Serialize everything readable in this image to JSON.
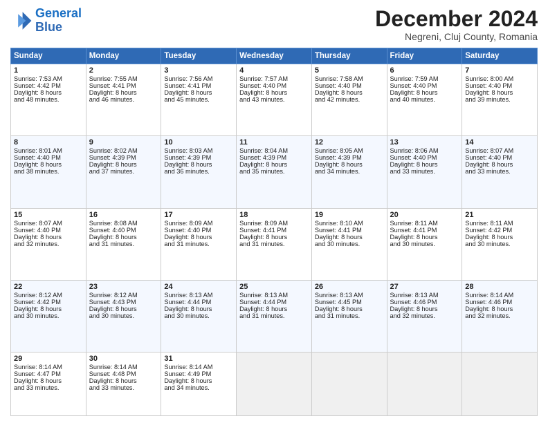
{
  "logo": {
    "line1": "General",
    "line2": "Blue"
  },
  "title": "December 2024",
  "location": "Negreni, Cluj County, Romania",
  "days_header": [
    "Sunday",
    "Monday",
    "Tuesday",
    "Wednesday",
    "Thursday",
    "Friday",
    "Saturday"
  ],
  "weeks": [
    [
      {
        "day": "1",
        "lines": [
          "Sunrise: 7:53 AM",
          "Sunset: 4:42 PM",
          "Daylight: 8 hours",
          "and 48 minutes."
        ]
      },
      {
        "day": "2",
        "lines": [
          "Sunrise: 7:55 AM",
          "Sunset: 4:41 PM",
          "Daylight: 8 hours",
          "and 46 minutes."
        ]
      },
      {
        "day": "3",
        "lines": [
          "Sunrise: 7:56 AM",
          "Sunset: 4:41 PM",
          "Daylight: 8 hours",
          "and 45 minutes."
        ]
      },
      {
        "day": "4",
        "lines": [
          "Sunrise: 7:57 AM",
          "Sunset: 4:40 PM",
          "Daylight: 8 hours",
          "and 43 minutes."
        ]
      },
      {
        "day": "5",
        "lines": [
          "Sunrise: 7:58 AM",
          "Sunset: 4:40 PM",
          "Daylight: 8 hours",
          "and 42 minutes."
        ]
      },
      {
        "day": "6",
        "lines": [
          "Sunrise: 7:59 AM",
          "Sunset: 4:40 PM",
          "Daylight: 8 hours",
          "and 40 minutes."
        ]
      },
      {
        "day": "7",
        "lines": [
          "Sunrise: 8:00 AM",
          "Sunset: 4:40 PM",
          "Daylight: 8 hours",
          "and 39 minutes."
        ]
      }
    ],
    [
      {
        "day": "8",
        "lines": [
          "Sunrise: 8:01 AM",
          "Sunset: 4:40 PM",
          "Daylight: 8 hours",
          "and 38 minutes."
        ]
      },
      {
        "day": "9",
        "lines": [
          "Sunrise: 8:02 AM",
          "Sunset: 4:39 PM",
          "Daylight: 8 hours",
          "and 37 minutes."
        ]
      },
      {
        "day": "10",
        "lines": [
          "Sunrise: 8:03 AM",
          "Sunset: 4:39 PM",
          "Daylight: 8 hours",
          "and 36 minutes."
        ]
      },
      {
        "day": "11",
        "lines": [
          "Sunrise: 8:04 AM",
          "Sunset: 4:39 PM",
          "Daylight: 8 hours",
          "and 35 minutes."
        ]
      },
      {
        "day": "12",
        "lines": [
          "Sunrise: 8:05 AM",
          "Sunset: 4:39 PM",
          "Daylight: 8 hours",
          "and 34 minutes."
        ]
      },
      {
        "day": "13",
        "lines": [
          "Sunrise: 8:06 AM",
          "Sunset: 4:40 PM",
          "Daylight: 8 hours",
          "and 33 minutes."
        ]
      },
      {
        "day": "14",
        "lines": [
          "Sunrise: 8:07 AM",
          "Sunset: 4:40 PM",
          "Daylight: 8 hours",
          "and 33 minutes."
        ]
      }
    ],
    [
      {
        "day": "15",
        "lines": [
          "Sunrise: 8:07 AM",
          "Sunset: 4:40 PM",
          "Daylight: 8 hours",
          "and 32 minutes."
        ]
      },
      {
        "day": "16",
        "lines": [
          "Sunrise: 8:08 AM",
          "Sunset: 4:40 PM",
          "Daylight: 8 hours",
          "and 31 minutes."
        ]
      },
      {
        "day": "17",
        "lines": [
          "Sunrise: 8:09 AM",
          "Sunset: 4:40 PM",
          "Daylight: 8 hours",
          "and 31 minutes."
        ]
      },
      {
        "day": "18",
        "lines": [
          "Sunrise: 8:09 AM",
          "Sunset: 4:41 PM",
          "Daylight: 8 hours",
          "and 31 minutes."
        ]
      },
      {
        "day": "19",
        "lines": [
          "Sunrise: 8:10 AM",
          "Sunset: 4:41 PM",
          "Daylight: 8 hours",
          "and 30 minutes."
        ]
      },
      {
        "day": "20",
        "lines": [
          "Sunrise: 8:11 AM",
          "Sunset: 4:41 PM",
          "Daylight: 8 hours",
          "and 30 minutes."
        ]
      },
      {
        "day": "21",
        "lines": [
          "Sunrise: 8:11 AM",
          "Sunset: 4:42 PM",
          "Daylight: 8 hours",
          "and 30 minutes."
        ]
      }
    ],
    [
      {
        "day": "22",
        "lines": [
          "Sunrise: 8:12 AM",
          "Sunset: 4:42 PM",
          "Daylight: 8 hours",
          "and 30 minutes."
        ]
      },
      {
        "day": "23",
        "lines": [
          "Sunrise: 8:12 AM",
          "Sunset: 4:43 PM",
          "Daylight: 8 hours",
          "and 30 minutes."
        ]
      },
      {
        "day": "24",
        "lines": [
          "Sunrise: 8:13 AM",
          "Sunset: 4:44 PM",
          "Daylight: 8 hours",
          "and 30 minutes."
        ]
      },
      {
        "day": "25",
        "lines": [
          "Sunrise: 8:13 AM",
          "Sunset: 4:44 PM",
          "Daylight: 8 hours",
          "and 31 minutes."
        ]
      },
      {
        "day": "26",
        "lines": [
          "Sunrise: 8:13 AM",
          "Sunset: 4:45 PM",
          "Daylight: 8 hours",
          "and 31 minutes."
        ]
      },
      {
        "day": "27",
        "lines": [
          "Sunrise: 8:13 AM",
          "Sunset: 4:46 PM",
          "Daylight: 8 hours",
          "and 32 minutes."
        ]
      },
      {
        "day": "28",
        "lines": [
          "Sunrise: 8:14 AM",
          "Sunset: 4:46 PM",
          "Daylight: 8 hours",
          "and 32 minutes."
        ]
      }
    ],
    [
      {
        "day": "29",
        "lines": [
          "Sunrise: 8:14 AM",
          "Sunset: 4:47 PM",
          "Daylight: 8 hours",
          "and 33 minutes."
        ]
      },
      {
        "day": "30",
        "lines": [
          "Sunrise: 8:14 AM",
          "Sunset: 4:48 PM",
          "Daylight: 8 hours",
          "and 33 minutes."
        ]
      },
      {
        "day": "31",
        "lines": [
          "Sunrise: 8:14 AM",
          "Sunset: 4:49 PM",
          "Daylight: 8 hours",
          "and 34 minutes."
        ]
      },
      {
        "day": "",
        "lines": []
      },
      {
        "day": "",
        "lines": []
      },
      {
        "day": "",
        "lines": []
      },
      {
        "day": "",
        "lines": []
      }
    ]
  ]
}
